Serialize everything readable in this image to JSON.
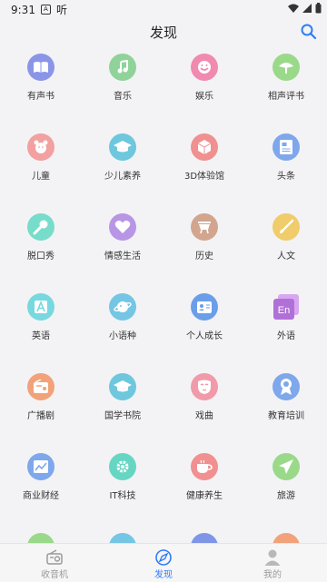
{
  "status_bar": {
    "time": "9:31",
    "app_label": "听"
  },
  "header": {
    "title": "发现"
  },
  "categories": [
    {
      "label": "有声书",
      "color": "#8b95e8",
      "icon": "book-icon"
    },
    {
      "label": "音乐",
      "color": "#8fd39a",
      "icon": "music-note-icon"
    },
    {
      "label": "娱乐",
      "color": "#f08ab0",
      "icon": "smiley-icon"
    },
    {
      "label": "相声评书",
      "color": "#9ad98a",
      "icon": "fan-icon"
    },
    {
      "label": "儿童",
      "color": "#f2a0a0",
      "icon": "bear-icon"
    },
    {
      "label": "少儿素养",
      "color": "#6ec7dd",
      "icon": "graduation-cap-icon"
    },
    {
      "label": "3D体验馆",
      "color": "#f09090",
      "icon": "cube-icon"
    },
    {
      "label": "头条",
      "color": "#7ea7ec",
      "icon": "newspaper-icon"
    },
    {
      "label": "脱口秀",
      "color": "#78dccb",
      "icon": "microphone-icon"
    },
    {
      "label": "情感生活",
      "color": "#b995e6",
      "icon": "heart-icon"
    },
    {
      "label": "历史",
      "color": "#d2a58e",
      "icon": "ding-vessel-icon"
    },
    {
      "label": "人文",
      "color": "#f0cc6a",
      "icon": "brush-icon"
    },
    {
      "label": "英语",
      "color": "#78d8e0",
      "icon": "letter-a-icon"
    },
    {
      "label": "小语种",
      "color": "#74c6e4",
      "icon": "planet-icon"
    },
    {
      "label": "个人成长",
      "color": "#6b9ee8",
      "icon": "id-card-icon"
    },
    {
      "label": "外语",
      "color": "#b070d8",
      "icon": "en-badge-icon"
    },
    {
      "label": "广播剧",
      "color": "#f2a27a",
      "icon": "radio-icon"
    },
    {
      "label": "国学书院",
      "color": "#6ec7dd",
      "icon": "graduation-cap-icon"
    },
    {
      "label": "戏曲",
      "color": "#f09aaa",
      "icon": "opera-mask-icon"
    },
    {
      "label": "教育培训",
      "color": "#7ea7ec",
      "icon": "award-icon"
    },
    {
      "label": "商业财经",
      "color": "#7ea7ec",
      "icon": "chart-icon"
    },
    {
      "label": "IT科技",
      "color": "#66d6c3",
      "icon": "gear-icon"
    },
    {
      "label": "健康养生",
      "color": "#f09090",
      "icon": "teacup-icon"
    },
    {
      "label": "旅游",
      "color": "#9ad98a",
      "icon": "airplane-icon"
    },
    {
      "label": "",
      "color": "#9ad98a",
      "icon": "partial-icon"
    },
    {
      "label": "",
      "color": "#74c6e4",
      "icon": "partial-icon"
    },
    {
      "label": "",
      "color": "#7e95e8",
      "icon": "partial-icon"
    },
    {
      "label": "",
      "color": "#f2a27a",
      "icon": "partial-icon"
    }
  ],
  "tabs": [
    {
      "label": "收音机",
      "icon": "radio-icon",
      "active": false
    },
    {
      "label": "发现",
      "icon": "compass-icon",
      "active": true
    },
    {
      "label": "我的",
      "icon": "person-icon",
      "active": false
    }
  ],
  "colors": {
    "accent": "#2f7df6",
    "inactive": "#9a9a9a"
  }
}
